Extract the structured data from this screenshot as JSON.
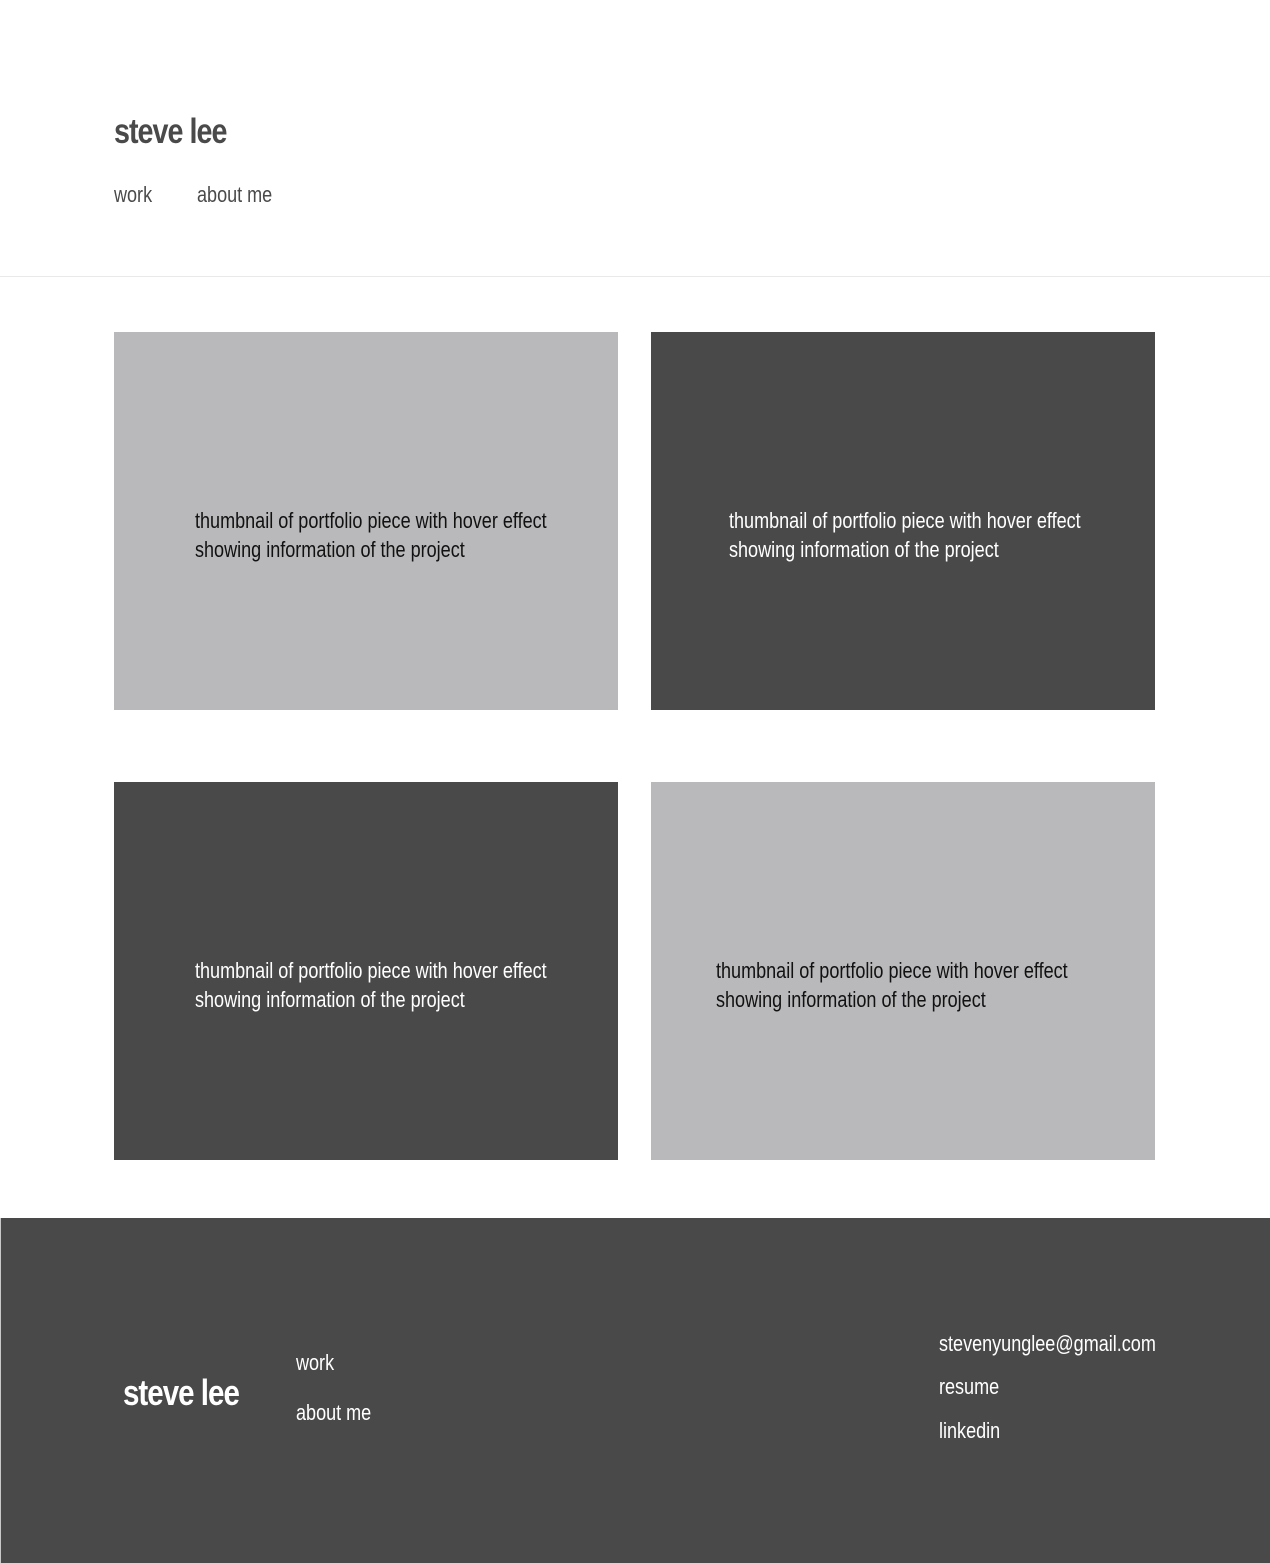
{
  "header": {
    "brand": "steve lee",
    "nav": {
      "work": "work",
      "about": "about me"
    }
  },
  "portfolio": {
    "tiles": [
      {
        "line1": "thumbnail of portfolio piece with  hover effect",
        "line2": "showing information of the project",
        "tone": "light"
      },
      {
        "line1": "thumbnail of portfolio piece with  hover effect",
        "line2": "showing information of the project",
        "tone": "dark"
      },
      {
        "line1": "thumbnail of portfolio piece with  hover effect",
        "line2": "showing information of the project",
        "tone": "dark"
      },
      {
        "line1": "thumbnail of portfolio piece with  hover effect",
        "line2": "showing information of the project",
        "tone": "light"
      }
    ]
  },
  "footer": {
    "brand": "steve lee",
    "nav": {
      "work": "work",
      "about": "about me"
    },
    "contact": {
      "email": "stevenyunglee@gmail.com",
      "resume": "resume",
      "linkedin": "linkedin"
    }
  },
  "colors": {
    "dark_gray": "#494949",
    "light_gray": "#b9b9bb",
    "brand_text": "#4a4a4a",
    "background": "#ffffff"
  }
}
